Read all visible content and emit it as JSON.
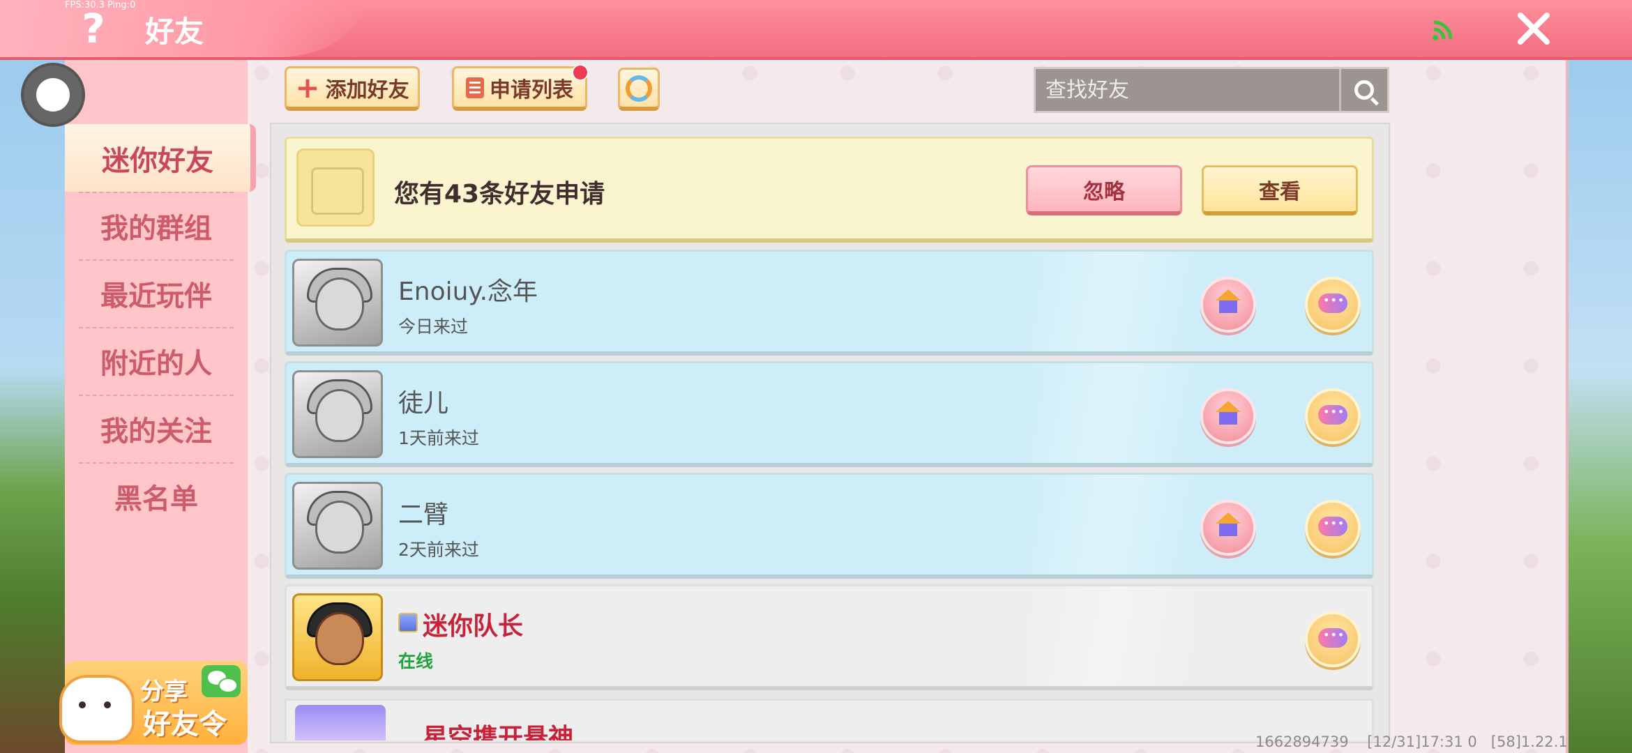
{
  "fps_text": "FPS:30.3  Ping:0",
  "header": {
    "title": "好友",
    "help_icon": "help-icon",
    "close_icon": "close-icon",
    "signal_icon": "wifi-icon"
  },
  "sidebar": {
    "items": [
      {
        "label": "迷你好友",
        "active": true
      },
      {
        "label": "我的群组"
      },
      {
        "label": "最近玩伴"
      },
      {
        "label": "附近的人"
      },
      {
        "label": "我的关注"
      },
      {
        "label": "黑名单"
      }
    ],
    "share": {
      "line1": "分享",
      "line2": "好友令"
    }
  },
  "toolbar": {
    "add_friend": "添加好友",
    "apply_list": "申请列表",
    "search_placeholder": "查找好友"
  },
  "request": {
    "text": "您有43条好友申请",
    "ignore": "忽略",
    "view": "查看"
  },
  "friends": [
    {
      "name": "Enoiuy.念年",
      "status": "今日来过"
    },
    {
      "name": "徒儿",
      "status": "1天前来过"
    },
    {
      "name": "二臂",
      "status": "2天前来过"
    },
    {
      "name": "迷你队长",
      "status": "在线"
    },
    {
      "name": "星空携开悬神"
    }
  ],
  "footer": {
    "text": "1662894739    [12/31]17:31 0   [58]1.22.1"
  },
  "colors": {
    "header": "#f26f80",
    "sidebar": "#ffc5c9",
    "friend_row": "#cdeef9",
    "request_row": "#fbf5cf"
  }
}
